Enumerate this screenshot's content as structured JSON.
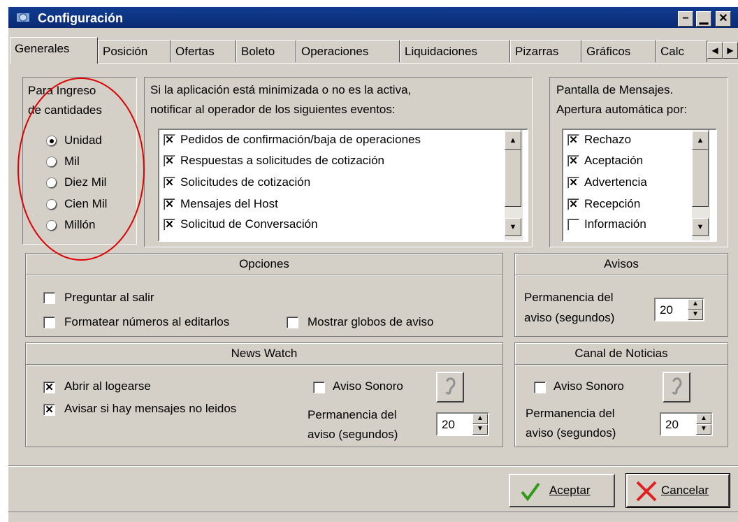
{
  "window": {
    "title": "Configuración"
  },
  "title_buttons": {
    "minimize": "−",
    "restore": "▁",
    "close": "✕"
  },
  "tabs": [
    "Generales",
    "Posición",
    "Ofertas",
    "Boleto",
    "Operaciones",
    "Liquidaciones",
    "Pizarras",
    "Gráficos",
    "Calc"
  ],
  "tab_scroll": {
    "left": "◀",
    "right": "▶"
  },
  "ingreso": {
    "label_line1": "Para Ingreso",
    "label_line2": "de cantidades",
    "options": [
      "Unidad",
      "Mil",
      "Diez Mil",
      "Cien Mil",
      "Millón"
    ],
    "selected": "Unidad"
  },
  "notificar": {
    "label_line1": "Si la aplicación está minimizada o no es la activa,",
    "label_line2": "notificar al operador de los siguientes eventos:",
    "items": [
      {
        "label": "Pedidos de confirmación/baja de operaciones",
        "checked": true
      },
      {
        "label": "Respuestas a solicitudes de cotización",
        "checked": true
      },
      {
        "label": "Solicitudes de cotización",
        "checked": true
      },
      {
        "label": "Mensajes del Host",
        "checked": true
      },
      {
        "label": "Solicitud de Conversación",
        "checked": true
      }
    ]
  },
  "mensajes": {
    "label_line1": "Pantalla de Mensajes.",
    "label_line2": "Apertura automática por:",
    "items": [
      {
        "label": "Rechazo",
        "checked": true
      },
      {
        "label": "Aceptación",
        "checked": true
      },
      {
        "label": "Advertencia",
        "checked": true
      },
      {
        "label": "Recepción",
        "checked": true
      },
      {
        "label": "Información",
        "checked": false
      }
    ]
  },
  "opciones": {
    "title": "Opciones",
    "preguntar": "Preguntar al salir",
    "formatear": "Formatear números al editarlos",
    "globos": "Mostrar globos de aviso"
  },
  "avisos": {
    "title": "Avisos",
    "label_line1": "Permanencia del",
    "label_line2": "aviso (segundos)",
    "value": "20"
  },
  "newswatch": {
    "title": "News Watch",
    "abrir": "Abrir al logearse",
    "avisar": "Avisar si hay mensajes no leidos",
    "sonoro": "Aviso Sonoro",
    "label_line1": "Permanencia del",
    "label_line2": "aviso (segundos)",
    "value": "20"
  },
  "canal": {
    "title": "Canal de Noticias",
    "sonoro": "Aviso Sonoro",
    "label_line1": "Permanencia del",
    "label_line2": "aviso (segundos)",
    "value": "20"
  },
  "buttons": {
    "aceptar": "Aceptar",
    "cancelar": "Cancelar"
  },
  "colors": {
    "titlebar": "#0a2a73",
    "annotation": "#e00000",
    "check_ok": "#2e9a1a",
    "cancel_x": "#e02020"
  }
}
